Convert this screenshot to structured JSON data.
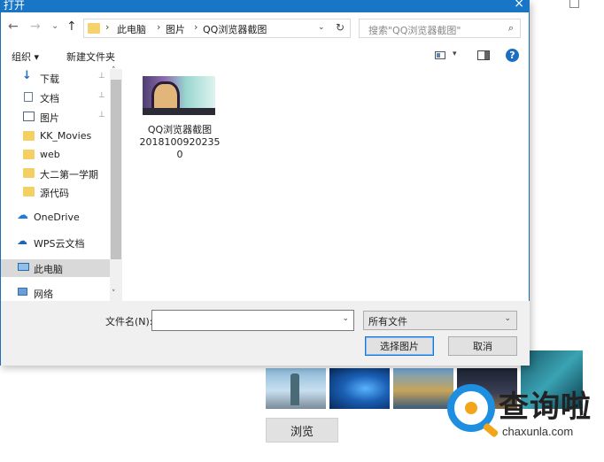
{
  "dialog": {
    "title": "打开",
    "close_glyph": "×"
  },
  "address": {
    "back": "←",
    "forward": "→",
    "recent": "⌄",
    "up": "↑",
    "crumbs": [
      "此电脑",
      "图片",
      "QQ浏览器截图"
    ],
    "crumb_sep": "›",
    "dropdown": "⌄",
    "refresh": "↻"
  },
  "search": {
    "placeholder": "搜索\"QQ浏览器截图\"",
    "icon": "⌕"
  },
  "toolbar": {
    "organize": "组织 ▾",
    "new_folder": "新建文件夹",
    "view_dropdown": "▾",
    "help": "?"
  },
  "nav": {
    "items": [
      {
        "label": "下载",
        "icon": "download-icon",
        "pinned": true
      },
      {
        "label": "文档",
        "icon": "document-icon",
        "pinned": true
      },
      {
        "label": "图片",
        "icon": "pictures-icon",
        "pinned": true
      },
      {
        "label": "KK_Movies",
        "icon": "folder-icon",
        "pinned": false
      },
      {
        "label": "web",
        "icon": "folder-icon",
        "pinned": false
      },
      {
        "label": "大二第一学期",
        "icon": "folder-icon",
        "pinned": false
      },
      {
        "label": "源代码",
        "icon": "folder-icon",
        "pinned": false
      },
      {
        "label": "OneDrive",
        "icon": "cloud-icon",
        "pinned": false
      },
      {
        "label": "WPS云文档",
        "icon": "wps-cloud-icon",
        "pinned": false
      },
      {
        "label": "此电脑",
        "icon": "computer-icon",
        "pinned": false,
        "selected": true
      },
      {
        "label": "网络",
        "icon": "network-icon",
        "pinned": false
      }
    ],
    "pin_glyph": "📌",
    "scroll_up": "˄",
    "scroll_down": "˅"
  },
  "files": [
    {
      "name_line1": "QQ浏览器截图",
      "name_line2": "2018100920235",
      "name_line3": "0"
    }
  ],
  "bottom": {
    "filename_label": "文件名(N):",
    "filename_value": "",
    "filename_dropdown": "⌄",
    "filetype": "所有文件",
    "filetype_dropdown": "⌄",
    "open_button": "选择图片",
    "cancel_button": "取消"
  },
  "background": {
    "browse_button": "浏览"
  },
  "watermark": {
    "title": "查询啦",
    "url": "chaxunla.com"
  },
  "colors": {
    "titlebar": "#1976c6",
    "accent_button_border": "#1976d2",
    "selected_nav": "#d9d9d9",
    "watermark_blue": "#1e8fe0",
    "watermark_orange": "#f2a51a"
  }
}
